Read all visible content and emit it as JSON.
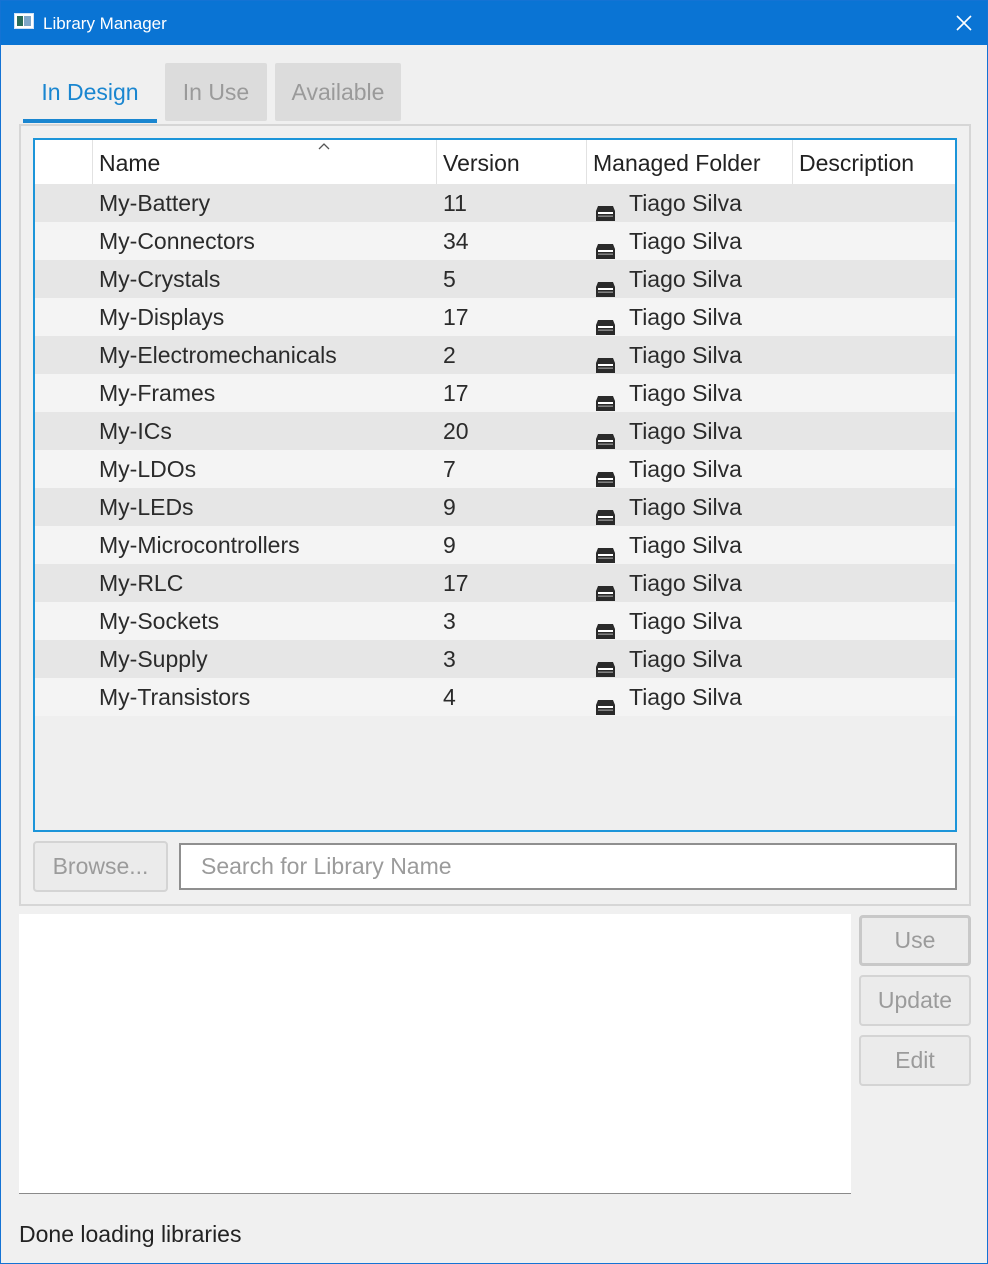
{
  "window": {
    "title": "Library Manager"
  },
  "tabs": [
    {
      "label": "In Design",
      "active": true
    },
    {
      "label": "In Use",
      "active": false
    },
    {
      "label": "Available",
      "active": false
    }
  ],
  "table": {
    "columns": [
      "",
      "Name",
      "Version",
      "Managed Folder",
      "Description"
    ],
    "sorted_by": "Name",
    "rows": [
      {
        "name": "My-Battery",
        "version": "11",
        "folder": "Tiago Silva",
        "description": ""
      },
      {
        "name": "My-Connectors",
        "version": "34",
        "folder": "Tiago Silva",
        "description": ""
      },
      {
        "name": "My-Crystals",
        "version": "5",
        "folder": "Tiago Silva",
        "description": ""
      },
      {
        "name": "My-Displays",
        "version": "17",
        "folder": "Tiago Silva",
        "description": ""
      },
      {
        "name": "My-Electromechanicals",
        "version": "2",
        "folder": "Tiago Silva",
        "description": ""
      },
      {
        "name": "My-Frames",
        "version": "17",
        "folder": "Tiago Silva",
        "description": ""
      },
      {
        "name": "My-ICs",
        "version": "20",
        "folder": "Tiago Silva",
        "description": ""
      },
      {
        "name": "My-LDOs",
        "version": "7",
        "folder": "Tiago Silva",
        "description": ""
      },
      {
        "name": "My-LEDs",
        "version": "9",
        "folder": "Tiago Silva",
        "description": ""
      },
      {
        "name": "My-Microcontrollers",
        "version": "9",
        "folder": "Tiago Silva",
        "description": ""
      },
      {
        "name": "My-RLC",
        "version": "17",
        "folder": "Tiago Silva",
        "description": ""
      },
      {
        "name": "My-Sockets",
        "version": "3",
        "folder": "Tiago Silva",
        "description": ""
      },
      {
        "name": "My-Supply",
        "version": "3",
        "folder": "Tiago Silva",
        "description": ""
      },
      {
        "name": "My-Transistors",
        "version": "4",
        "folder": "Tiago Silva",
        "description": ""
      }
    ]
  },
  "browse": {
    "label": "Browse..."
  },
  "search": {
    "placeholder": "Search for Library Name",
    "value": ""
  },
  "actions": {
    "use": "Use",
    "update": "Update",
    "edit": "Edit"
  },
  "status": {
    "text": "Done loading libraries"
  },
  "colors": {
    "titlebar": "#0a74d4",
    "accent": "#1a86d0",
    "table_border": "#1c95d9"
  },
  "icons": {
    "row_folder": "managed-folder-icon",
    "close": "close-icon",
    "app": "library-app-icon"
  }
}
